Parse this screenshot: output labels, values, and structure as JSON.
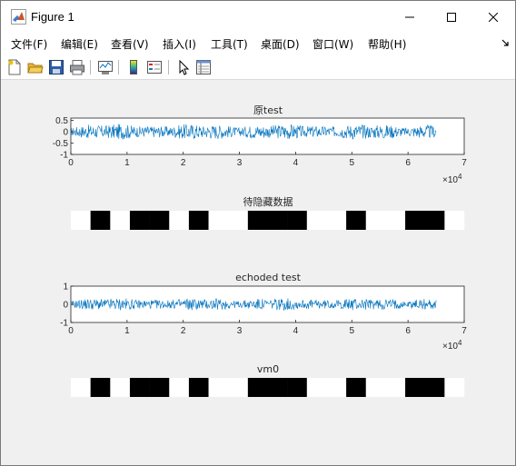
{
  "window": {
    "title": "Figure 1",
    "controls": {
      "minimize": "minimize",
      "maximize": "maximize",
      "close": "close"
    }
  },
  "menu": {
    "items": [
      "文件(F)",
      "编辑(E)",
      "查看(V)",
      "插入(I)",
      "工具(T)",
      "桌面(D)",
      "窗口(W)",
      "帮助(H)"
    ]
  },
  "toolbar": {
    "icons": [
      "new-figure-icon",
      "open-file-icon",
      "save-icon",
      "print-icon",
      "link-plot-icon",
      "insert-colorbar-icon",
      "insert-legend-icon",
      "edit-plot-icon",
      "property-inspector-icon"
    ]
  },
  "colors": {
    "signal": "#0072bd",
    "bar_on": "#000000",
    "bar_off": "#ffffff",
    "axes_bg": "#ffffff",
    "figure_bg": "#f0f0f0"
  },
  "chart_data": [
    {
      "type": "line",
      "title": "原test",
      "xlim": [
        0,
        7
      ],
      "ylim": [
        -1,
        0.6
      ],
      "xticks": [
        "0",
        "1",
        "2",
        "3",
        "4",
        "5",
        "6",
        "7"
      ],
      "yticks": [
        "0.5",
        "0",
        "-0.5",
        "-1"
      ],
      "x_exponent": "×10",
      "x_exponent_power": "4",
      "signal_extent_x": [
        0,
        6.5
      ],
      "amplitude": 0.3
    },
    {
      "type": "heatmap",
      "title": "待隐藏数据",
      "bits": [
        0,
        1,
        0,
        1,
        1,
        0,
        1,
        0,
        0,
        1,
        1,
        1,
        0,
        0,
        1,
        0,
        0,
        1,
        1,
        0
      ]
    },
    {
      "type": "line",
      "title": "echoded test",
      "xlim": [
        0,
        7
      ],
      "ylim": [
        -1,
        1
      ],
      "xticks": [
        "0",
        "1",
        "2",
        "3",
        "4",
        "5",
        "6",
        "7"
      ],
      "yticks": [
        "1",
        "0",
        "-1"
      ],
      "x_exponent": "×10",
      "x_exponent_power": "4",
      "signal_extent_x": [
        0,
        6.5
      ],
      "amplitude": 0.3
    },
    {
      "type": "heatmap",
      "title": "vm0",
      "bits": [
        0,
        1,
        0,
        1,
        1,
        0,
        1,
        0,
        0,
        1,
        1,
        1,
        0,
        0,
        1,
        0,
        0,
        1,
        1,
        0
      ]
    }
  ]
}
